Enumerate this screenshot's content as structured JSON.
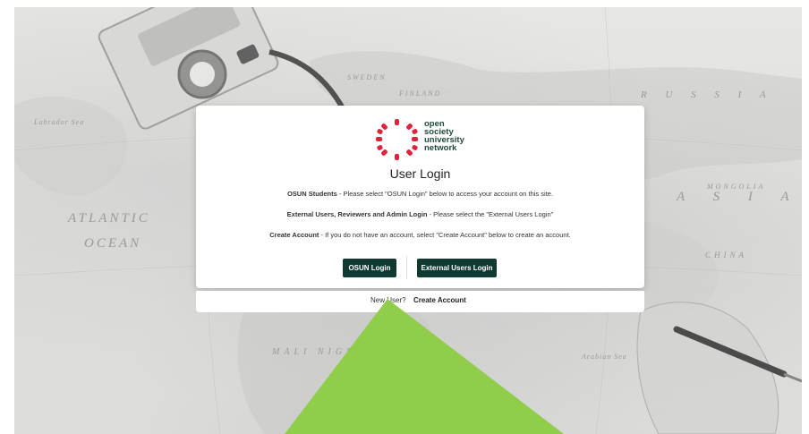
{
  "background": {
    "map_labels": {
      "atlantic": "ATLANTIC",
      "ocean": "OCEAN",
      "russia": "R U S S I A",
      "asia": "A S I A",
      "mongolia": "MONGOLIA",
      "china": "CHINA",
      "mali": "MALI  NIGER",
      "sweden": "SWEDEN",
      "finland": "FINLAND",
      "labrador": "Labrador Sea",
      "arabian": "Arabian Sea"
    }
  },
  "logo": {
    "line1": "open",
    "line2": "society",
    "line3": "university",
    "line4": "network",
    "ring_color": "#e0223a",
    "text_color": "#1f4a3f"
  },
  "login": {
    "title": "User Login",
    "osun_students_label": "OSUN Students",
    "osun_students_text": " - Please select \"OSUN Login\" below to access your account on this site.",
    "external_label": "External Users, Reviewers and Admin Login",
    "external_text": " - Please select the \"External Users Login\"",
    "create_label": "Create Account",
    "create_text": " - If you do not have an account, select \"Create Account\" below to create an account.",
    "osun_button": "OSUN Login",
    "external_button": "External Users Login",
    "new_user_text": "New User?",
    "create_account_link": "Create Account"
  },
  "overlay": {
    "triangle_color": "#8fcd4a"
  },
  "colors": {
    "button_bg": "#0f3a32"
  }
}
